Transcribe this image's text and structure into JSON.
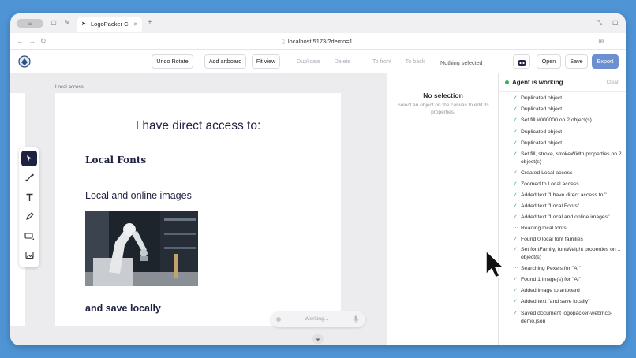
{
  "browser": {
    "tab_title": "LogoPacker C",
    "url": "localhost:5173/?demo=1"
  },
  "toolbar": {
    "undo": "Undo Rotate",
    "add_artboard": "Add artboard",
    "fit_view": "Fit view",
    "duplicate": "Duplicate",
    "delete": "Delete",
    "to_front": "To front",
    "to_back": "To back",
    "selection_status": "Nothing selected",
    "open": "Open",
    "save": "Save",
    "export": "Export"
  },
  "canvas": {
    "artboard_label": "Local access",
    "title": "I have direct access to:",
    "fonts_line": "Local Fonts",
    "images_line": "Local and online images",
    "save_line": "and save locally",
    "working_placeholder": "Working..."
  },
  "properties": {
    "heading": "No selection",
    "hint": "Select an object on the canvas to edit its properties."
  },
  "agent": {
    "title": "Agent is working",
    "clear": "Clear",
    "items": [
      {
        "status": "done",
        "text": "Duplicated object"
      },
      {
        "status": "done",
        "text": "Duplicated object"
      },
      {
        "status": "done",
        "text": "Set fill #000000 on 2 object(s)"
      },
      {
        "status": "done",
        "text": "Duplicated object"
      },
      {
        "status": "done",
        "text": "Duplicated object"
      },
      {
        "status": "done",
        "text": "Set fill, stroke, strokeWidth properties on 2 object(s)"
      },
      {
        "status": "done",
        "text": "Created Local access"
      },
      {
        "status": "done",
        "text": "Zoomed to Local access"
      },
      {
        "status": "done",
        "text": "Added text \"I have direct access to:\""
      },
      {
        "status": "done",
        "text": "Added text \"Local Fonts\""
      },
      {
        "status": "done",
        "text": "Added text \"Local and online images\""
      },
      {
        "status": "progress",
        "text": "Reading local fonts"
      },
      {
        "status": "done",
        "text": "Found 0 local font families"
      },
      {
        "status": "done",
        "text": "Set fontFamily, fontWeight properties on 1 object(s)"
      },
      {
        "status": "progress",
        "text": "Searching Pexels for \"AI\""
      },
      {
        "status": "done",
        "text": "Found 1 image(s) for \"AI\""
      },
      {
        "status": "done",
        "text": "Added image to artboard"
      },
      {
        "status": "done",
        "text": "Added text \"and save locally\""
      },
      {
        "status": "done",
        "text": "Saved document logopacker-webmcp-demo.json"
      }
    ]
  },
  "colors": {
    "accent": "#1e2140",
    "export_button": "#6b8fd1",
    "success": "#2fa84f",
    "desktop": "#4f95d6"
  },
  "icons": {
    "tools": [
      "select-arrow-icon",
      "path-icon",
      "text-icon",
      "pen-icon",
      "rectangle-icon",
      "image-icon"
    ]
  }
}
